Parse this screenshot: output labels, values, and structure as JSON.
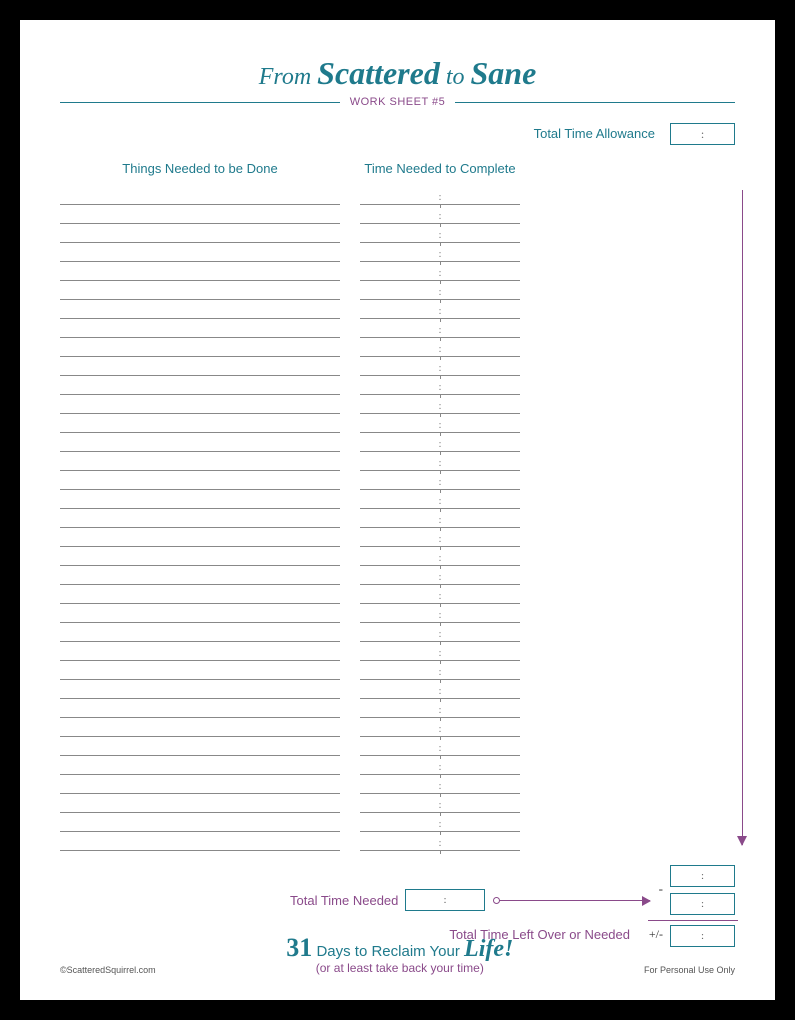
{
  "header": {
    "from": "From",
    "scattered": "Scattered",
    "to": "to",
    "sane": "Sane",
    "subtitle": "WORK SHEET #5"
  },
  "labels": {
    "total_time_allowance": "Total Time Allowance",
    "things_needed": "Things Needed to be Done",
    "time_needed": "Time Needed to Complete",
    "total_time_needed": "Total Time Needed",
    "leftover": "Total Time Left Over or Needed",
    "minus": "-",
    "plusminus": "+/-",
    "colon": ":"
  },
  "rows": {
    "count": 35
  },
  "footer": {
    "copyright": "©ScatteredSquirrel.com",
    "big_number": "31",
    "tag_middle": "Days to Reclaim Your",
    "life": "Life!",
    "sub": "(or at least take back your time)",
    "personal": "For Personal Use Only"
  }
}
